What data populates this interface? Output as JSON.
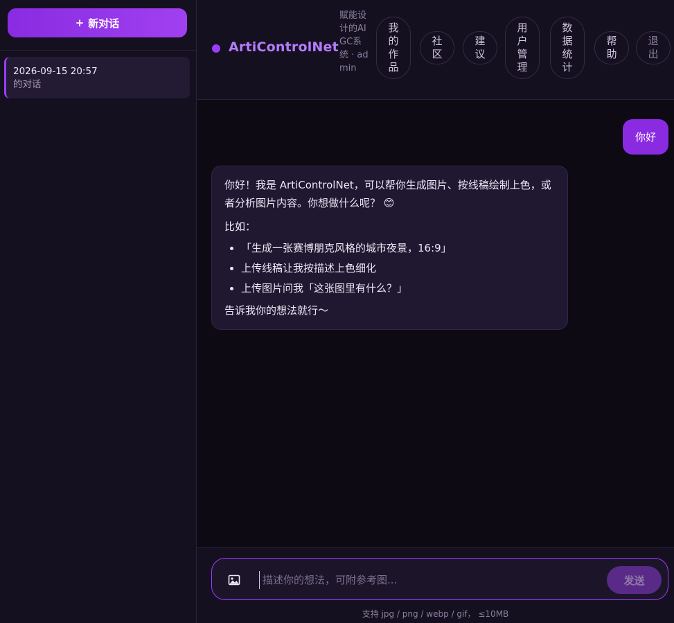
{
  "sidebar": {
    "new_chat_icon": "+",
    "new_chat_label": "新对话",
    "conversations": [
      {
        "title": "2026-09-15 20:57",
        "subtitle": "的对话"
      }
    ]
  },
  "header": {
    "brand": "ArtiControlNet",
    "subtitle": "赋能设计的AIGC系统 · admin",
    "nav": [
      {
        "label": "我的作品"
      },
      {
        "label": "社区"
      },
      {
        "label": "建议"
      },
      {
        "label": "用户管理"
      },
      {
        "label": "数据统计"
      },
      {
        "label": "帮助"
      },
      {
        "label": "退出"
      }
    ]
  },
  "chat": {
    "user_message": "你好",
    "bot": {
      "intro": "你好！我是 ArtiControlNet，可以帮你生成图片、按线稿绘制上色，或者分析图片内容。你想做什么呢？ 😊",
      "examples_label": "比如：",
      "examples": [
        "「生成一张赛博朋克风格的城市夜景，16:9」",
        "上传线稿让我按描述上色细化",
        "上传图片问我「这张图里有什么？」"
      ],
      "outro": "告诉我你的想法就行～"
    }
  },
  "input": {
    "attach_icon": "image-upload-icon",
    "placeholder": "描述你的想法，可附参考图...",
    "send_label": "发送",
    "hint": "支持 jpg / png / webp / gif， ≤10MB"
  },
  "colors": {
    "accent": "#8a2be2",
    "brand_text": "#b57cff",
    "background": "#0d0a14",
    "panel": "#15101f"
  }
}
